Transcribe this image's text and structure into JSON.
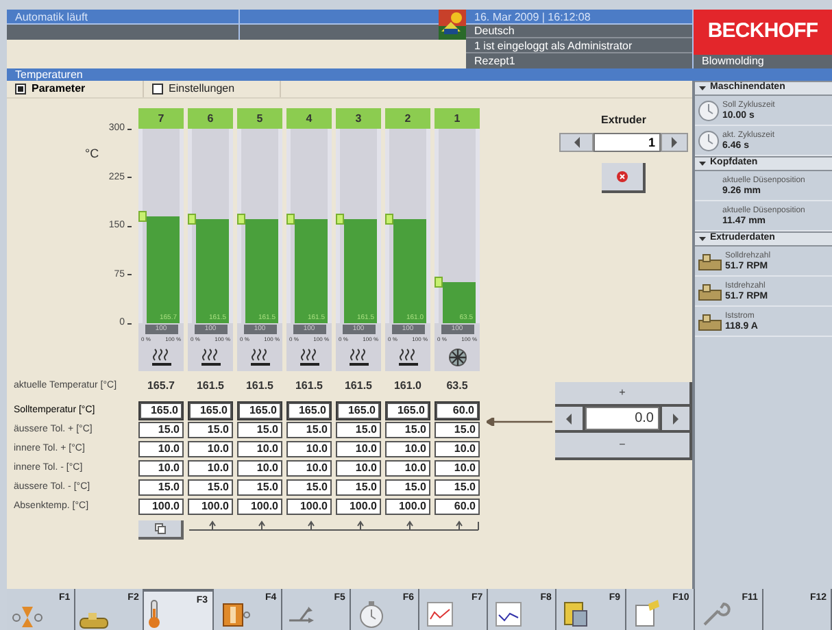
{
  "header": {
    "status": "Automatik läuft",
    "datetime": "16. Mar 2009 | 16:12:08",
    "language": "Deutsch",
    "user": "1 ist eingeloggt als Administrator",
    "recipe": "Rezept1",
    "logo": "BECKHOFF",
    "machine": "Blowmolding"
  },
  "title": "Temperaturen",
  "tabs": [
    {
      "label": "Parameter",
      "selected": true
    },
    {
      "label": "Einstellungen",
      "selected": false
    }
  ],
  "chart": {
    "unit": "°C",
    "ticks": [
      "300",
      "225",
      "150",
      "75",
      "0"
    ]
  },
  "zones": [
    {
      "label": "7",
      "level": 0.552,
      "bar_reading": "165.7",
      "output": "100",
      "scale_min": "0 %",
      "scale_max": "100 %",
      "kind": "heating"
    },
    {
      "label": "6",
      "level": 0.538,
      "bar_reading": "161.5",
      "output": "100",
      "scale_min": "0 %",
      "scale_max": "100 %",
      "kind": "heating"
    },
    {
      "label": "5",
      "level": 0.538,
      "bar_reading": "161.5",
      "output": "100",
      "scale_min": "0 %",
      "scale_max": "100 %",
      "kind": "heating"
    },
    {
      "label": "4",
      "level": 0.538,
      "bar_reading": "161.5",
      "output": "100",
      "scale_min": "0 %",
      "scale_max": "100 %",
      "kind": "heating"
    },
    {
      "label": "3",
      "level": 0.538,
      "bar_reading": "161.5",
      "output": "100",
      "scale_min": "0 %",
      "scale_max": "100 %",
      "kind": "heating"
    },
    {
      "label": "2",
      "level": 0.537,
      "bar_reading": "161.0",
      "output": "100",
      "scale_min": "0 %",
      "scale_max": "100 %",
      "kind": "heating"
    },
    {
      "label": "1",
      "level": 0.212,
      "bar_reading": "63.5",
      "output": "100",
      "scale_min": "0 %",
      "scale_max": "100 %",
      "kind": "cooling"
    }
  ],
  "actual_row": {
    "label": "aktuelle Temperatur [°C]",
    "values": [
      "165.7",
      "161.5",
      "161.5",
      "161.5",
      "161.5",
      "161.0",
      "63.5"
    ]
  },
  "table_rows": [
    {
      "label": "Solltemperatur [°C]",
      "selected": true,
      "cells": [
        "165.0",
        "165.0",
        "165.0",
        "165.0",
        "165.0",
        "165.0",
        "60.0"
      ]
    },
    {
      "label": "äussere Tol. + [°C]",
      "selected": false,
      "cells": [
        "15.0",
        "15.0",
        "15.0",
        "15.0",
        "15.0",
        "15.0",
        "15.0"
      ]
    },
    {
      "label": "innere Tol. + [°C]",
      "selected": false,
      "cells": [
        "10.0",
        "10.0",
        "10.0",
        "10.0",
        "10.0",
        "10.0",
        "10.0"
      ]
    },
    {
      "label": "innere Tol. - [°C]",
      "selected": false,
      "cells": [
        "10.0",
        "10.0",
        "10.0",
        "10.0",
        "10.0",
        "10.0",
        "10.0"
      ]
    },
    {
      "label": "äussere Tol. - [°C]",
      "selected": false,
      "cells": [
        "15.0",
        "15.0",
        "15.0",
        "15.0",
        "15.0",
        "15.0",
        "15.0"
      ]
    },
    {
      "label": "Absenktemp. [°C]",
      "selected": false,
      "cells": [
        "100.0",
        "100.0",
        "100.0",
        "100.0",
        "100.0",
        "100.0",
        "60.0"
      ]
    }
  ],
  "extruder": {
    "label": "Extruder",
    "value": "1"
  },
  "adjust": {
    "plus": "+",
    "value": "0.0",
    "minus": "−"
  },
  "side_panel": [
    {
      "title": "Maschinendaten",
      "expanded": true,
      "items": [
        {
          "kind": "clock",
          "label": "Soll Zykluszeit",
          "value": "10.00 s"
        },
        {
          "kind": "clock",
          "label": "akt. Zykluszeit",
          "value": "6.46 s"
        }
      ]
    },
    {
      "title": "Kopfdaten",
      "expanded": true,
      "items": [
        {
          "kind": "none",
          "label": "aktuelle Düsenposition",
          "value": "9.26 mm"
        },
        {
          "kind": "none",
          "label": "aktuelle Düsenposition",
          "value": "11.47 mm"
        }
      ]
    },
    {
      "title": "Extruderdaten",
      "expanded": true,
      "items": [
        {
          "kind": "extruder",
          "label": "Solldrehzahl",
          "value": "51.7 RPM"
        },
        {
          "kind": "extruder",
          "label": "Istdrehzahl",
          "value": "51.7 RPM"
        },
        {
          "kind": "extruder",
          "label": "Iststrom",
          "value": "118.9 A"
        }
      ]
    }
  ],
  "toolbar": [
    {
      "key": "F1",
      "kind": "valve",
      "selected": false
    },
    {
      "key": "F2",
      "kind": "extruder",
      "selected": false
    },
    {
      "key": "F3",
      "kind": "thermometer",
      "selected": true
    },
    {
      "key": "F4",
      "kind": "mold",
      "selected": false
    },
    {
      "key": "F5",
      "kind": "flow",
      "selected": false
    },
    {
      "key": "F6",
      "kind": "timer",
      "selected": false
    },
    {
      "key": "F7",
      "kind": "chart",
      "selected": false
    },
    {
      "key": "F8",
      "kind": "trend",
      "selected": false
    },
    {
      "key": "F9",
      "kind": "recipe",
      "selected": false
    },
    {
      "key": "F10",
      "kind": "edit",
      "selected": false
    },
    {
      "key": "F11",
      "kind": "tool",
      "selected": false
    },
    {
      "key": "F12",
      "kind": "none",
      "selected": false
    }
  ]
}
